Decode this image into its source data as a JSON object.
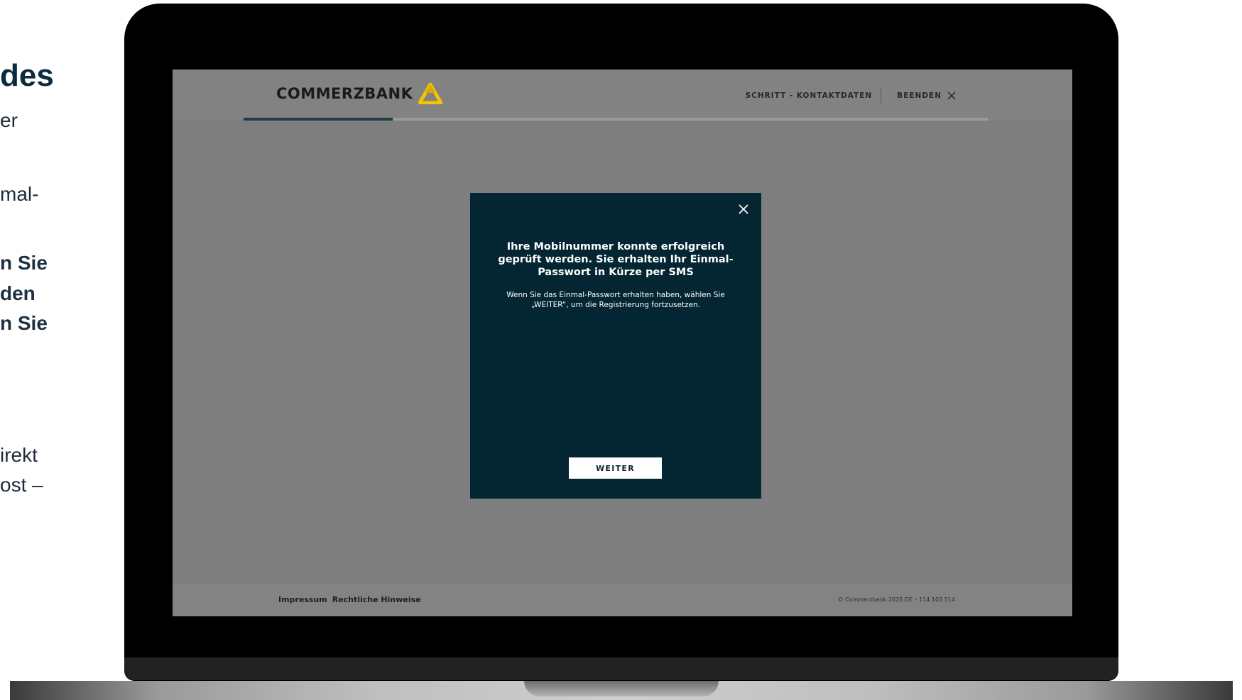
{
  "background_page": {
    "fragments": [
      {
        "text": "des",
        "style": "heading"
      },
      {
        "text": "er",
        "style": "normal"
      },
      {
        "text": "mal-",
        "style": "normal"
      },
      {
        "text": "n Sie",
        "style": "bold"
      },
      {
        "text": "den",
        "style": "bold"
      },
      {
        "text": "n Sie",
        "style": "bold"
      },
      {
        "text": "irekt",
        "style": "normal"
      },
      {
        "text": "ost –",
        "style": "normal"
      }
    ]
  },
  "header": {
    "logo_text": "COMMERZBANK",
    "step_label": "SCHRITT - KONTAKTDATEN",
    "exit_label": "BEENDEN",
    "progress": 0.2
  },
  "modal": {
    "title": "Ihre Mobilnummer konnte erfolgreich geprüft werden. Sie erhalten Ihr Einmal-Passwort in Kürze per SMS",
    "body": "Wenn Sie das Einmal-Passwort erhalten haben, wählen Sie „WEITER“, um die Registrierung fortzusetzen.",
    "button_label": "WEITER",
    "close_icon": "close-icon"
  },
  "footer": {
    "links": [
      "Impressum",
      "Rechtliche Hinweise"
    ],
    "copyright": "© Commerzbank 2025 DE – 114 103 514"
  },
  "colors": {
    "modal_bg": "#032632",
    "logo_yellow": "#f5c400",
    "overlay_grey": "#7e7e7e",
    "progress_fill": "#1f3c47"
  }
}
